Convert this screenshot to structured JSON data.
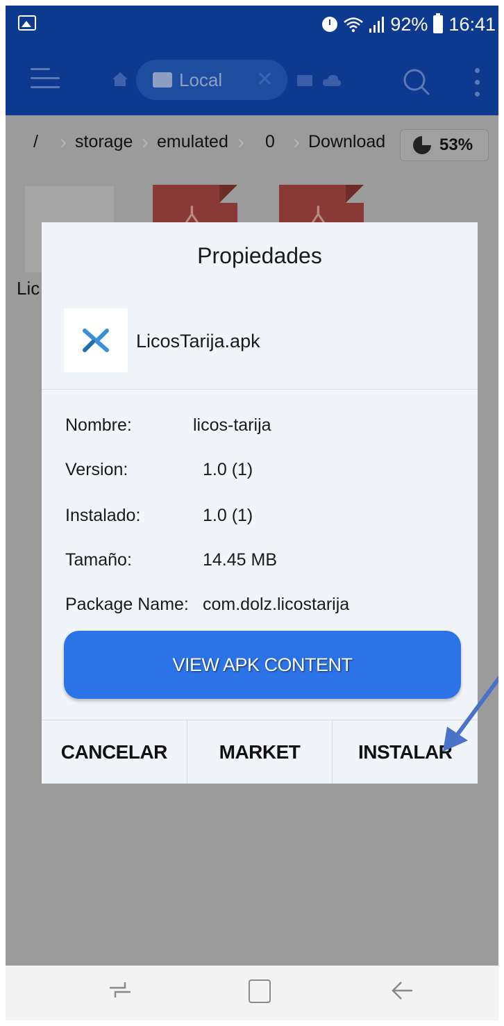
{
  "status_bar": {
    "battery": "92%",
    "time": "16:41",
    "icons": [
      "image-icon",
      "alarm-icon",
      "wifi-icon",
      "signal-icon",
      "battery-icon"
    ]
  },
  "toolbar": {
    "tab_label": "Local",
    "icons": [
      "menu-icon",
      "home-icon",
      "drive-icon",
      "close-icon",
      "cloud-icon",
      "search-icon",
      "more-icon"
    ]
  },
  "breadcrumb": {
    "items": [
      "/",
      "storage",
      "emulated",
      "0",
      "Download"
    ],
    "storage_percent": "53%"
  },
  "file_area": {
    "partial_label": "Lic"
  },
  "dialog": {
    "title": "Propiedades",
    "file_name": "LicosTarija.apk",
    "properties": [
      {
        "label": "Nombre:",
        "value": "licos-tarija"
      },
      {
        "label": "Version:",
        "value": "1.0 (1)"
      },
      {
        "label": "Instalado:",
        "value": "1.0 (1)"
      },
      {
        "label": "Tamaño:",
        "value": "14.45 MB"
      },
      {
        "label": "Package Name:",
        "value": "com.dolz.licostarija"
      }
    ],
    "view_button": "VIEW APK CONTENT",
    "actions": {
      "cancel": "CANCELAR",
      "market": "MARKET",
      "install": "INSTALAR"
    }
  },
  "colors": {
    "toolbar_bg": "#0d3a8e",
    "button_blue": "#2b73e6",
    "dialog_bg": "#f1f4f8",
    "arrow": "#4a72c8"
  }
}
